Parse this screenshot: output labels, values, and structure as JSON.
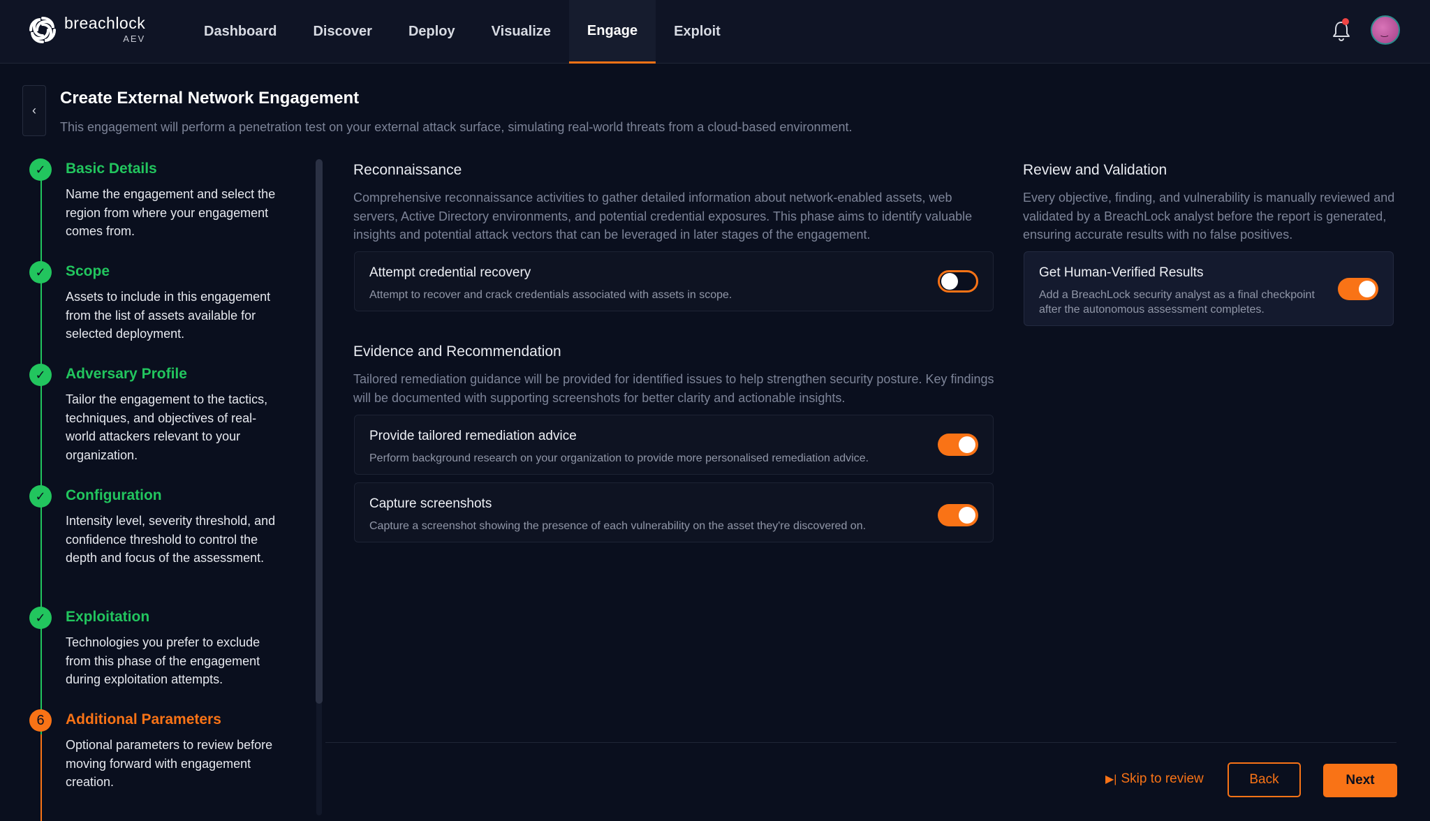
{
  "brand": {
    "name": "breachlock",
    "product": "AEV"
  },
  "nav": {
    "items": [
      {
        "label": "Dashboard",
        "active": false
      },
      {
        "label": "Discover",
        "active": false
      },
      {
        "label": "Deploy",
        "active": false
      },
      {
        "label": "Visualize",
        "active": false
      },
      {
        "label": "Engage",
        "active": true
      },
      {
        "label": "Exploit",
        "active": false
      }
    ]
  },
  "header": {
    "back_glyph": "‹",
    "title": "Create External Network Engagement",
    "subtitle": "This engagement will perform a penetration test on your external attack surface, simulating real-world threats from a cloud-based environment."
  },
  "steps": [
    {
      "marker": "✓",
      "title": "Basic Details",
      "description": "Name the engagement and select the region from where your engagement comes from.",
      "status": "complete"
    },
    {
      "marker": "✓",
      "title": "Scope",
      "description": "Assets to include in this engagement from the list of assets available for selected deployment.",
      "status": "complete"
    },
    {
      "marker": "✓",
      "title": "Adversary Profile",
      "description": "Tailor the engagement to the tactics, techniques, and objectives of real-world attackers relevant to your organization.",
      "status": "complete"
    },
    {
      "marker": "✓",
      "title": "Configuration",
      "description": "Intensity level, severity threshold, and confidence threshold to control the depth and focus of the assessment.",
      "status": "complete"
    },
    {
      "marker": "✓",
      "title": "Exploitation",
      "description": "Technologies you prefer to exclude from this phase of the engagement during exploitation attempts.",
      "status": "complete"
    },
    {
      "marker": "6",
      "title": "Additional Parameters",
      "description": "Optional parameters to review before moving forward with engagement creation.",
      "status": "current"
    }
  ],
  "reconnaissance": {
    "title": "Reconnaissance",
    "description": "Comprehensive reconnaissance activities to gather detailed information about network-enabled assets, web servers, Active Directory environments, and potential credential exposures. This phase aims to identify valuable insights and potential attack vectors that can be leveraged in later stages of the engagement.",
    "options": [
      {
        "title": "Attempt credential recovery",
        "description": "Attempt to recover and crack credentials associated with assets in scope.",
        "enabled": false
      }
    ]
  },
  "evidence": {
    "title": "Evidence and Recommendation",
    "description": "Tailored remediation guidance will be provided for identified issues to help strengthen security posture. Key findings will be documented with supporting screenshots for better clarity and actionable insights.",
    "options": [
      {
        "title": "Provide tailored remediation advice",
        "description": "Perform background research on your organization to provide more personalised remediation advice.",
        "enabled": true
      },
      {
        "title": "Capture screenshots",
        "description": "Capture a screenshot showing the presence of each vulnerability on the asset they're discovered on.",
        "enabled": true
      }
    ]
  },
  "review": {
    "title": "Review and Validation",
    "description": "Every objective, finding, and vulnerability is manually reviewed and validated by a BreachLock analyst before the report is generated, ensuring accurate results with no false positives.",
    "options": [
      {
        "title": "Get Human-Verified Results",
        "description": "Add a BreachLock security analyst as a final checkpoint after the autonomous assessment completes.",
        "enabled": true
      }
    ]
  },
  "footer": {
    "skip_icon": "▶|",
    "skip_label": "Skip to review",
    "back_label": "Back",
    "next_label": "Next"
  },
  "colors": {
    "accent": "#f97316",
    "success": "#22c55e",
    "background": "#0a0f1e",
    "notification": "#ef4444"
  },
  "icons": {
    "logo": "breachlock-swirl-icon",
    "bell": "bell-icon",
    "back": "chevron-left-icon",
    "check": "check-icon",
    "skip": "skip-forward-icon"
  }
}
